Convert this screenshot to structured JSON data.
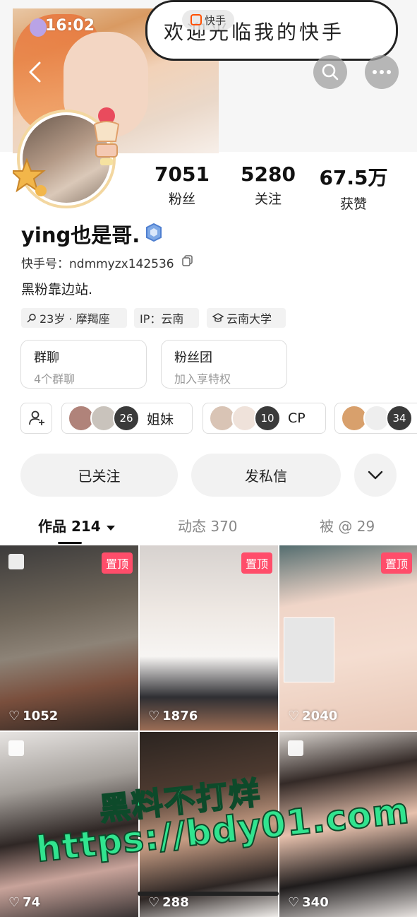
{
  "status_bar": {
    "time": "16:02"
  },
  "banner": {
    "bubble_text": "欢迎光临我的快手",
    "brand_label": "快手"
  },
  "stats": [
    {
      "value": "7051",
      "label": "粉丝"
    },
    {
      "value": "5280",
      "label": "关注"
    },
    {
      "value": "67.5万",
      "label": "获赞"
    }
  ],
  "profile": {
    "username": "ying也是哥.",
    "id_line": "快手号：ndmmyzx142536",
    "bio": "黑粉靠边站.",
    "tags": {
      "age": "23岁 · 摩羯座",
      "ip": "IP：云南",
      "school": "云南大学"
    }
  },
  "cards": [
    {
      "title": "群聊",
      "subtitle": "4个群聊"
    },
    {
      "title": "粉丝团",
      "subtitle": "加入享特权"
    }
  ],
  "circles": [
    {
      "name": "姐妹",
      "count": "26"
    },
    {
      "name": "CP",
      "count": "10"
    },
    {
      "name": "",
      "count": "34"
    }
  ],
  "actions": {
    "followed": "已关注",
    "message": "发私信"
  },
  "tabs": {
    "works": "作品 214",
    "feed": "动态 370",
    "mentioned": "被 @ 29"
  },
  "grid": [
    {
      "likes": "1052",
      "pinned": "置顶"
    },
    {
      "likes": "1876",
      "pinned": "置顶"
    },
    {
      "likes": "2040",
      "pinned": "置顶"
    },
    {
      "likes": "74",
      "pinned": ""
    },
    {
      "likes": "288",
      "pinned": ""
    },
    {
      "likes": "340",
      "pinned": ""
    }
  ],
  "watermark": {
    "line1": "黑料不打烊",
    "line2": "https://bdy01.com"
  }
}
